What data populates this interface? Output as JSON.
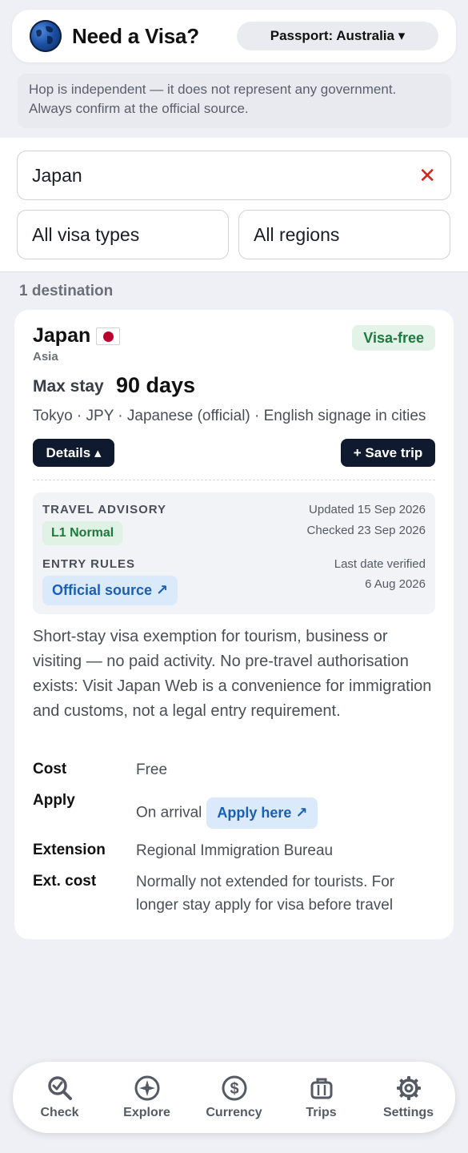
{
  "header": {
    "title": "Need a Visa?",
    "passport_label": "Passport: Australia ▾"
  },
  "disclaimer": {
    "line1": "Hop is independent — it does not represent any government.",
    "line2": "Always confirm at the official source."
  },
  "search": {
    "value": "Japan",
    "clear_icon": "✕"
  },
  "filters": {
    "visa_type": "All visa types",
    "region": "All regions"
  },
  "results_count": "1 destination",
  "card": {
    "country": "Japan",
    "flag_icon": "japan-flag",
    "region": "Asia",
    "status_badge": "Visa-free",
    "status_color": "#1d7a3c",
    "max_stay_label": "Max stay",
    "max_stay_value": "90 days",
    "meta": "Tokyo · JPY · Japanese (official) · English signage in cities",
    "details_button": "Details ▴",
    "save_button": "+ Save trip",
    "advisory": {
      "heading": "TRAVEL ADVISORY",
      "level": "L1 Normal",
      "updated": "Updated 15 Sep 2026",
      "checked": "Checked 23 Sep 2026"
    },
    "entry_rules": {
      "heading": "ENTRY RULES",
      "source_link": "Official source ↗",
      "verified_label": "Last date verified",
      "verified_date": "6 Aug 2026"
    },
    "description": "Short-stay visa exemption for tourism, business or visiting — no paid activity. No pre-travel authorisation exists: Visit Japan Web is a convenience for immigration and customs, not a legal entry requirement.",
    "rows": {
      "cost_label": "Cost",
      "cost_value": "Free",
      "apply_label": "Apply",
      "apply_value": "On arrival",
      "apply_link": "Apply here ↗",
      "extension_label": "Extension",
      "extension_value": "Regional Immigration Bureau",
      "ext_cost_label": "Ext. cost",
      "ext_cost_line1": "Normally not extended for tourists. For",
      "ext_cost_line2": "longer stay apply for visa before travel"
    }
  },
  "nav": [
    {
      "label": "Check",
      "icon": "search-check-icon"
    },
    {
      "label": "Explore",
      "icon": "compass-icon"
    },
    {
      "label": "Currency",
      "icon": "dollar-icon"
    },
    {
      "label": "Trips",
      "icon": "suitcase-icon"
    },
    {
      "label": "Settings",
      "icon": "gear-icon"
    }
  ],
  "colors": {
    "accent_dark": "#0f1a2e",
    "link_blue": "#1a5fb4",
    "clear_red": "#d3261b"
  }
}
